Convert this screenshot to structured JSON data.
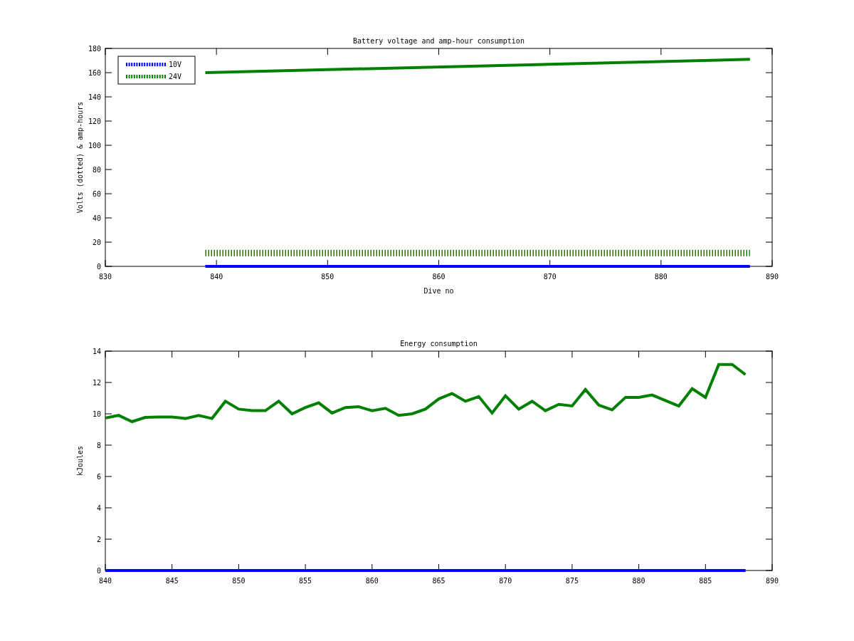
{
  "charts": [
    {
      "chart_data": {
        "type": "line",
        "title": "Battery voltage and amp-hour consumption",
        "xlabel": "Dive no",
        "legend": "upper left",
        "ylabel": "Volts (dotted) & amp-hours",
        "x": [
          839,
          888
        ],
        "xlim": [
          830,
          890
        ],
        "ylim": [
          0,
          180
        ],
        "xticks": [
          830,
          840,
          850,
          860,
          870,
          880,
          890
        ],
        "yticks": [
          0,
          20,
          40,
          60,
          80,
          100,
          120,
          140,
          160,
          180
        ],
        "series": [
          {
            "name": "10V",
            "color": "#0000ff",
            "line_style": "solid",
            "values": [
              0,
              0
            ]
          },
          {
            "name": "24V",
            "color": "#008000",
            "line_style": "dotted",
            "values": [
              11,
              11
            ]
          },
          {
            "color": "#008000",
            "line_style": "solid",
            "values": [
              160,
              171
            ]
          }
        ]
      }
    },
    {
      "chart_data": {
        "type": "line",
        "title": "Energy consumption",
        "ylabel": "kJoules",
        "x": [
          840,
          841,
          842,
          843,
          844,
          845,
          846,
          847,
          848,
          849,
          850,
          851,
          852,
          853,
          854,
          855,
          856,
          857,
          858,
          859,
          860,
          861,
          862,
          863,
          864,
          865,
          866,
          867,
          868,
          869,
          870,
          871,
          872,
          873,
          874,
          875,
          876,
          877,
          878,
          879,
          880,
          881,
          882,
          883,
          884,
          885,
          886,
          887,
          888
        ],
        "xlim": [
          840,
          890
        ],
        "ylim": [
          0,
          14
        ],
        "xticks": [
          840,
          845,
          850,
          855,
          860,
          865,
          870,
          875,
          880,
          885,
          890
        ],
        "yticks": [
          0,
          2,
          4,
          6,
          8,
          10,
          12,
          14
        ],
        "series": [
          {
            "color": "#008000",
            "line_style": "solid",
            "values": [
              9.73,
              9.9,
              9.5,
              9.77,
              9.8,
              9.8,
              9.7,
              9.9,
              9.7,
              10.8,
              10.3,
              10.2,
              10.2,
              10.8,
              10.0,
              10.4,
              10.7,
              10.05,
              10.4,
              10.45,
              10.2,
              10.35,
              9.9,
              10.0,
              10.3,
              10.95,
              11.3,
              10.8,
              11.1,
              10.05,
              11.15,
              10.3,
              10.8,
              10.2,
              10.6,
              10.5,
              11.55,
              10.55,
              10.25,
              11.05,
              11.05,
              11.2,
              10.85,
              10.5,
              11.6,
              11.05,
              13.15,
              13.15,
              12.5
            ]
          },
          {
            "color": "#0000ff",
            "line_style": "solid",
            "values": [
              0,
              0,
              0,
              0,
              0,
              0,
              0,
              0,
              0,
              0,
              0,
              0,
              0,
              0,
              0,
              0,
              0,
              0,
              0,
              0,
              0,
              0,
              0,
              0,
              0,
              0,
              0,
              0,
              0,
              0,
              0,
              0,
              0,
              0,
              0,
              0,
              0,
              0,
              0,
              0,
              0,
              0,
              0,
              0,
              0,
              0,
              0,
              0,
              0
            ]
          }
        ]
      }
    }
  ]
}
